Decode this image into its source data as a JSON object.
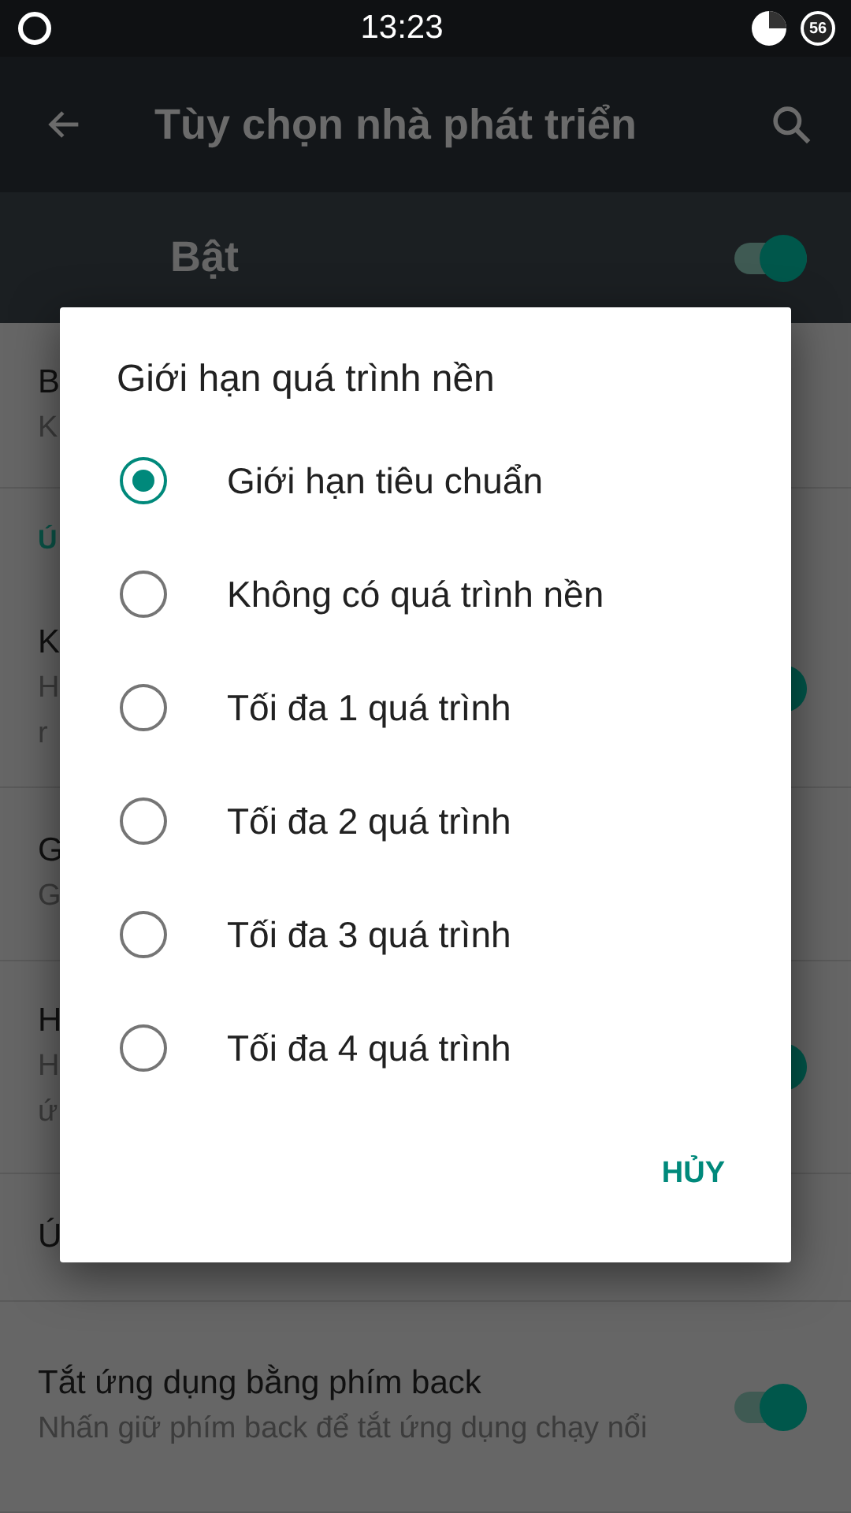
{
  "status_bar": {
    "time": "13:23",
    "badge": "56"
  },
  "toolbar": {
    "title": "Tùy chọn nhà phát triển"
  },
  "master": {
    "label": "Bật",
    "on": true
  },
  "rows": [
    {
      "kind": "setting",
      "title": "B",
      "lines": [
        "K"
      ]
    },
    {
      "kind": "category",
      "title": "Ú"
    },
    {
      "kind": "toggle",
      "title": "K",
      "lines": [
        "H",
        "r"
      ],
      "on": true
    },
    {
      "kind": "setting",
      "title": "G",
      "lines": [
        "G"
      ]
    },
    {
      "kind": "toggle",
      "title": "H",
      "lines": [
        "H",
        "ứ"
      ],
      "on": true
    },
    {
      "kind": "setting",
      "title": "Ú",
      "lines": []
    },
    {
      "kind": "toggle",
      "title": "Tắt ứng dụng bằng phím back",
      "lines": [
        "Nhấn giữ phím back để tắt ứng dụng chạy nổi"
      ],
      "on": true
    }
  ],
  "dialog": {
    "title": "Giới hạn quá trình nền",
    "options": [
      {
        "label": "Giới hạn tiêu chuẩn",
        "selected": true
      },
      {
        "label": "Không có quá trình nền",
        "selected": false
      },
      {
        "label": "Tối đa 1 quá trình",
        "selected": false
      },
      {
        "label": "Tối đa 2 quá trình",
        "selected": false
      },
      {
        "label": "Tối đa 3 quá trình",
        "selected": false
      },
      {
        "label": "Tối đa 4 quá trình",
        "selected": false
      }
    ],
    "cancel": "HỦY"
  }
}
